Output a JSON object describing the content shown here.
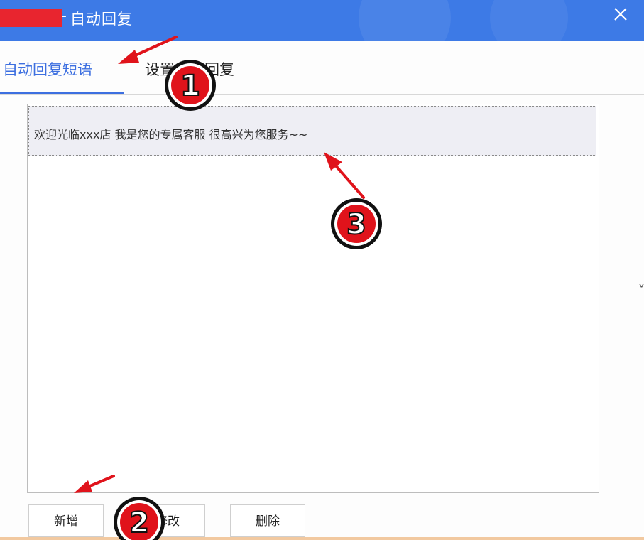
{
  "window": {
    "title": "自动回复",
    "title_prefix": "-",
    "close_icon": "close-icon"
  },
  "tabs": [
    {
      "label": "自动回复短语",
      "active": true
    },
    {
      "label": "设置自动回复",
      "active": false
    }
  ],
  "phrases": [
    {
      "text": "欢迎光临xxx店 我是您的专属客服 很高兴为您服务~~",
      "selected": true
    }
  ],
  "buttons": {
    "add_label": "新增",
    "edit_label": "修改",
    "delete_label": "删除"
  },
  "annotations": [
    {
      "number": "1"
    },
    {
      "number": "2"
    },
    {
      "number": "3"
    }
  ],
  "colors": {
    "titlebar": "#3d7ae6",
    "accent": "#3d6fe0",
    "annotation": "#e0131b",
    "redaction": "#e8252f"
  }
}
